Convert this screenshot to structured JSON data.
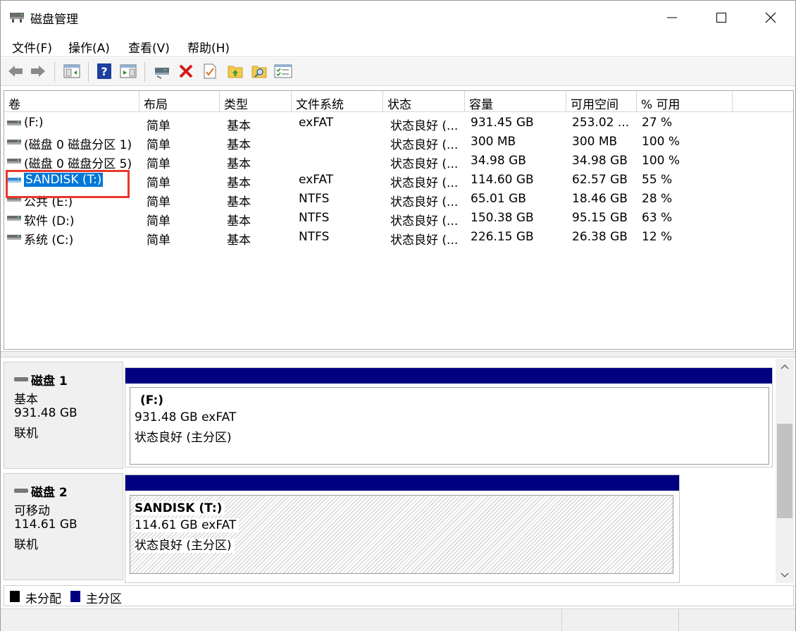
{
  "window": {
    "title": "磁盘管理"
  },
  "menu": [
    {
      "label": "文件(F)"
    },
    {
      "label": "操作(A)"
    },
    {
      "label": "查看(V)"
    },
    {
      "label": "帮助(H)"
    }
  ],
  "table": {
    "columns": [
      "卷",
      "布局",
      "类型",
      "文件系统",
      "状态",
      "容量",
      "可用空间",
      "% 可用"
    ],
    "rows": [
      {
        "volume": " (F:)",
        "layout": "简单",
        "type": "基本",
        "fs": "exFAT",
        "status": "状态良好 (...",
        "capacity": "931.45 GB",
        "free": "253.02 ...",
        "pct": "27 %"
      },
      {
        "volume": "(磁盘 0 磁盘分区 1)",
        "layout": "简单",
        "type": "基本",
        "fs": "",
        "status": "状态良好 (...",
        "capacity": "300 MB",
        "free": "300 MB",
        "pct": "100 %"
      },
      {
        "volume": "(磁盘 0 磁盘分区 5)",
        "layout": "简单",
        "type": "基本",
        "fs": "",
        "status": "状态良好 (...",
        "capacity": "34.98 GB",
        "free": "34.98 GB",
        "pct": "100 %"
      },
      {
        "volume": "SANDISK (T:)",
        "layout": "简单",
        "type": "基本",
        "fs": "exFAT",
        "status": "状态良好 (...",
        "capacity": "114.60 GB",
        "free": "62.57 GB",
        "pct": "55 %"
      },
      {
        "volume": "公共 (E:)",
        "layout": "简单",
        "type": "基本",
        "fs": "NTFS",
        "status": "状态良好 (...",
        "capacity": "65.01 GB",
        "free": "18.46 GB",
        "pct": "28 %"
      },
      {
        "volume": "软件 (D:)",
        "layout": "简单",
        "type": "基本",
        "fs": "NTFS",
        "status": "状态良好 (...",
        "capacity": "150.38 GB",
        "free": "95.15 GB",
        "pct": "63 %"
      },
      {
        "volume": "系统 (C:)",
        "layout": "简单",
        "type": "基本",
        "fs": "NTFS",
        "status": "状态良好 (...",
        "capacity": "226.15 GB",
        "free": "26.38 GB",
        "pct": "12 %"
      }
    ]
  },
  "disks": [
    {
      "name": "磁盘 1",
      "kind": "基本",
      "size": "931.48 GB",
      "state": "联机",
      "partition": {
        "name": "(F:)",
        "size_fs": "931.48 GB exFAT",
        "status": "状态良好 (主分区)"
      }
    },
    {
      "name": "磁盘 2",
      "kind": "可移动",
      "size": "114.61 GB",
      "state": "联机",
      "partition": {
        "name": "SANDISK  (T:)",
        "size_fs": "114.61 GB exFAT",
        "status": "状态良好 (主分区)"
      }
    }
  ],
  "legend": {
    "unallocated": "未分配",
    "primary": "主分区"
  },
  "colors": {
    "primary_partition": "#000080",
    "unallocated": "#000000",
    "selection": "#0078d7",
    "highlight_box": "#e8372e"
  }
}
